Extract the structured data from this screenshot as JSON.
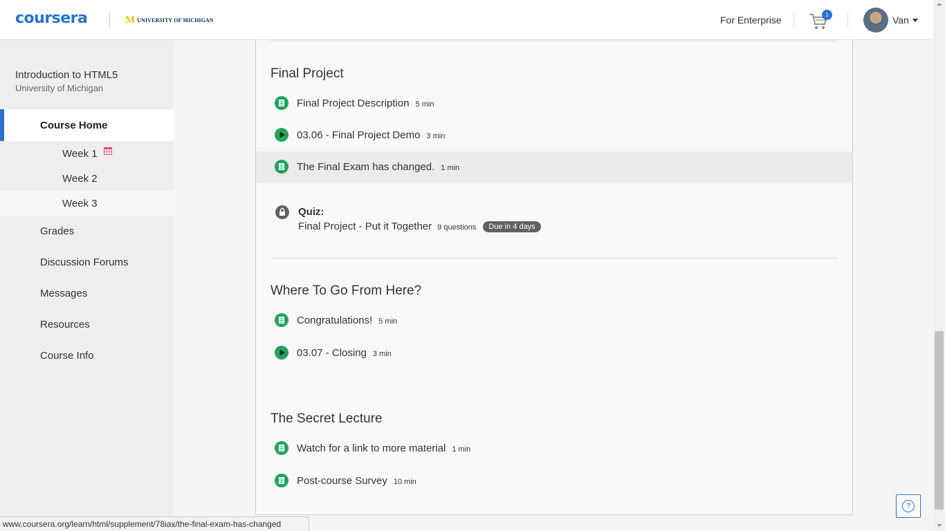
{
  "header": {
    "logo": "coursera",
    "partner_mark": "M",
    "partner_name": "UNIVERSITY OF MICHIGAN",
    "for_enterprise": "For Enterprise",
    "cart_count": "1",
    "user_name": "Van"
  },
  "sidebar": {
    "course_title": "Introduction to HTML5",
    "course_university": "University of Michigan",
    "course_home": "Course Home",
    "weeks": [
      "Week 1",
      "Week 2",
      "Week 3"
    ],
    "items": [
      "Grades",
      "Discussion Forums",
      "Messages",
      "Resources",
      "Course Info"
    ]
  },
  "sections": [
    {
      "title": "Final Project",
      "items": [
        {
          "type": "reading",
          "title": "Final Project Description",
          "duration": "5 min"
        },
        {
          "type": "video",
          "title": "03.06 - Final Project Demo",
          "duration": "3 min"
        },
        {
          "type": "reading",
          "title": "The Final Exam has changed.",
          "duration": "1 min"
        }
      ],
      "quiz": {
        "label": "Quiz:",
        "title": "Final Project - Put it Together",
        "questions": "9 questions",
        "due": "Due in 4 days"
      }
    },
    {
      "title": "Where To Go From Here?",
      "items": [
        {
          "type": "reading",
          "title": "Congratulations!",
          "duration": "5 min"
        },
        {
          "type": "video",
          "title": "03.07 - Closing",
          "duration": "3 min"
        }
      ]
    },
    {
      "title": "The Secret Lecture",
      "items": [
        {
          "type": "reading",
          "title": "Watch for a link to more material",
          "duration": "1 min"
        },
        {
          "type": "reading",
          "title": "Post-course Survey",
          "duration": "10 min"
        }
      ]
    }
  ],
  "help": "?",
  "status_url": "www.coursera.org/learn/html/supplement/78iax/the-final-exam-has-changed",
  "colors": {
    "brand": "#2a73cc",
    "complete_green": "#1fa55c",
    "badge_gray": "#616161"
  }
}
